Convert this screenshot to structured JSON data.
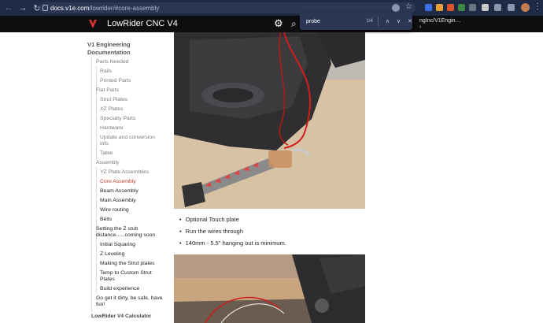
{
  "browser": {
    "url_host": "docs.v1e.com",
    "url_path": "/lowrider/#core-assembly",
    "find": {
      "query": "probe",
      "count": "1/4"
    }
  },
  "site": {
    "title": "LowRider CNC V4",
    "repo_text_line1": "ngInc/V1Engin…",
    "repo_text_line2": "›",
    "accent": "#c0392b"
  },
  "sidebar": {
    "heading_line1": "V1 Engineering",
    "heading_line2": "Documentation",
    "items": [
      {
        "label": "Parts Needed"
      },
      {
        "label": "Rails"
      },
      {
        "label": "Printed Parts"
      },
      {
        "label": "Flat Parts"
      },
      {
        "label": "Strut Plates"
      },
      {
        "label": "XZ Plates"
      },
      {
        "label": "Specialty Parts"
      },
      {
        "label": "Hardware"
      },
      {
        "label": "Update and conversion"
      },
      {
        "label": "info"
      },
      {
        "label": "Table"
      },
      {
        "label": "Assembly"
      },
      {
        "label": "YZ Plate Assemblies"
      },
      {
        "label": "Core Assembly"
      },
      {
        "label": "Beam Assembly"
      },
      {
        "label": "Main Assembly"
      },
      {
        "label": "Wire routing"
      },
      {
        "label": "Belts"
      },
      {
        "label": "Setting the Z stub"
      },
      {
        "label": "distance......coming soon"
      },
      {
        "label": "Initial Squaring"
      },
      {
        "label": "Z Leveling"
      },
      {
        "label": "Making the Strut plates"
      },
      {
        "label": "Temp to Custom Strut"
      },
      {
        "label": "Plates"
      },
      {
        "label": "Build experience"
      },
      {
        "label": "Go get it dirty, be safe, have"
      },
      {
        "label": "fun!"
      },
      {
        "label": "LowRider V4 Calculator"
      }
    ]
  },
  "content": {
    "bullets": [
      "Optional Touch plate",
      "Run the wires through",
      "140mm - 5.5\" hanging out is minimum."
    ]
  }
}
